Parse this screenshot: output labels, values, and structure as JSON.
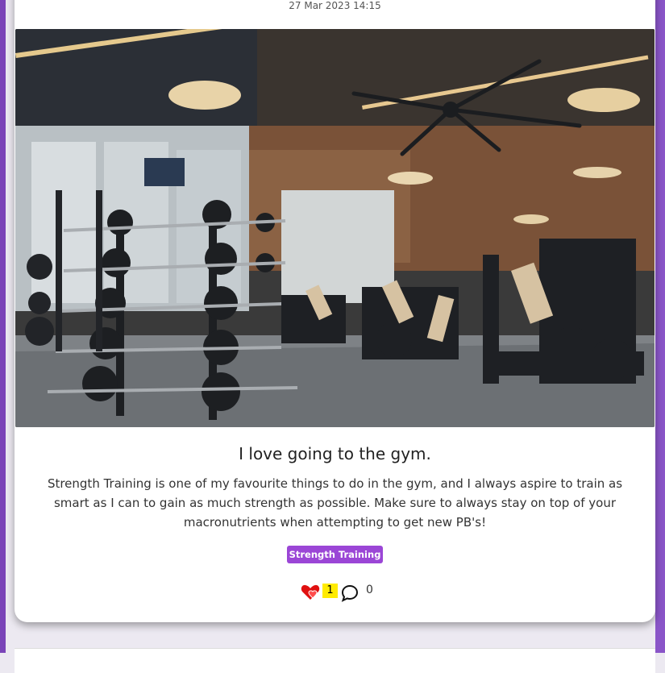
{
  "post": {
    "timestamp": "27 Mar 2023 14:15",
    "title": "I love going to the gym.",
    "body": "Strength Training is one of my favourite things to do in the gym, and I always aspire to train as smart as I can to gain as much strength as possible. Make sure to always stay on top of your macronutrients when attempting to get new PB's!",
    "tag": "Strength Training",
    "likes": "1",
    "comments": "0"
  },
  "icons": {
    "like": "heart-icon",
    "comment": "speech-bubble-icon"
  },
  "colors": {
    "accent": "#9b46d6",
    "background_frame": "#7a44b8",
    "like": "#e01010",
    "badge": "#ffeb00"
  }
}
